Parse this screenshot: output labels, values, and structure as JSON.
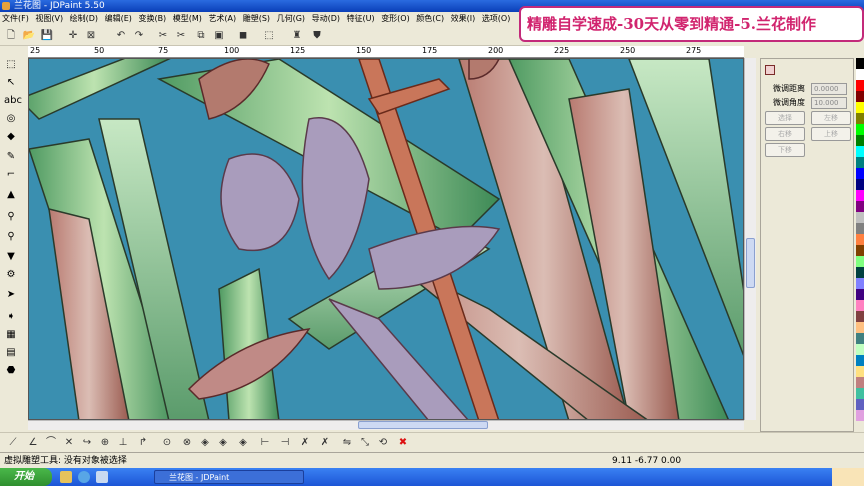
{
  "window": {
    "title": "兰花图 - JDPaint 5.50"
  },
  "menu": [
    "文件(F)",
    "视图(V)",
    "绘制(D)",
    "编辑(E)",
    "变换(B)",
    "模型(M)",
    "艺术(A)",
    "雕塑(S)",
    "几何(G)",
    "导动(D)",
    "特征(U)",
    "变形(O)",
    "颜色(C)",
    "效果(I)",
    "选项(O)"
  ],
  "overlay": {
    "banner": "精雕自学速成-30天从零到精通-5.兰花制作"
  },
  "ruler": {
    "ticks": [
      "25",
      "50",
      "75",
      "100",
      "125",
      "150",
      "175",
      "200",
      "225",
      "250",
      "275"
    ]
  },
  "panel": {
    "fields": [
      {
        "label": "微调距离",
        "value": "0.0000"
      },
      {
        "label": "微调角度",
        "value": "10.000"
      }
    ],
    "buttons": [
      "选择",
      "左移",
      "右移",
      "上移",
      "下移"
    ]
  },
  "palette": [
    "#000000",
    "#ffffff",
    "#ff0000",
    "#800000",
    "#ffff00",
    "#808000",
    "#00ff00",
    "#008000",
    "#00ffff",
    "#008080",
    "#0000ff",
    "#000080",
    "#ff00ff",
    "#800080",
    "#c0c0c0",
    "#808080",
    "#ff8040",
    "#804000",
    "#80ff80",
    "#004040",
    "#8080ff",
    "#400080",
    "#ff80c0",
    "#804040",
    "#ffc080",
    "#408080",
    "#c0ffc0",
    "#0080c0",
    "#ffe080",
    "#c08080",
    "#40c0a0",
    "#6060c0",
    "#e0a0e0"
  ],
  "status": {
    "message": "虚拟雕塑工具: 没有对象被选择",
    "coords": "9.11  -6.77  0.00"
  },
  "taskbar": {
    "start": "开始",
    "item": "兰花图 - JDPaint"
  }
}
